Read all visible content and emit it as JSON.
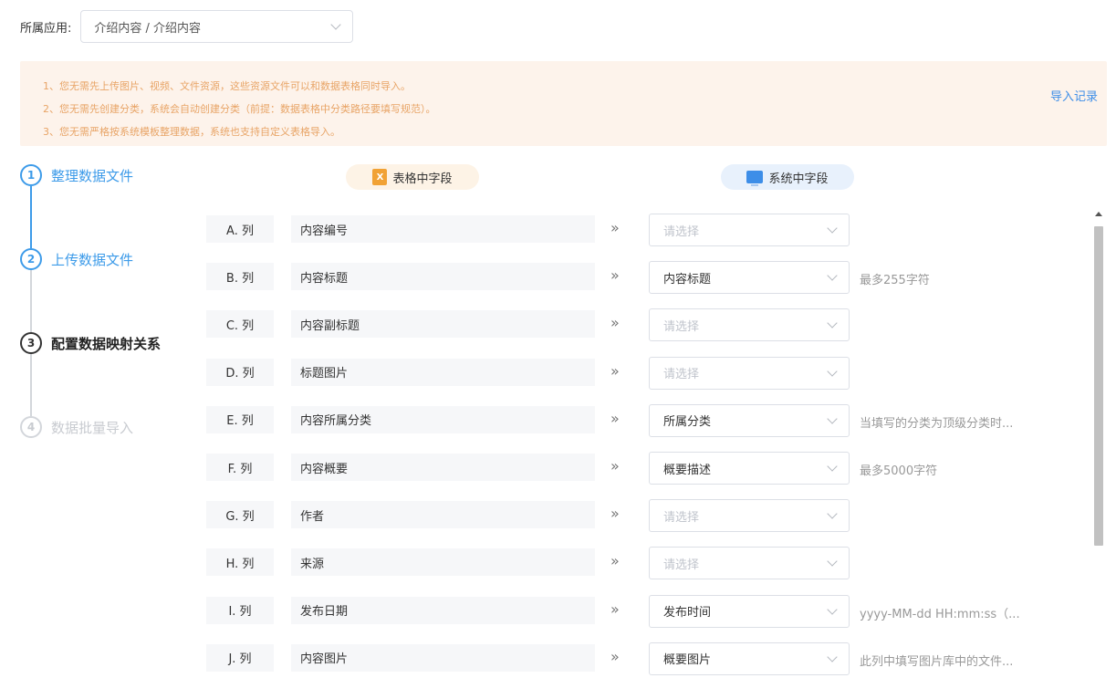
{
  "header": {
    "app_label": "所属应用:",
    "app_value": "介绍内容 / 介绍内容"
  },
  "notice": {
    "lines": [
      "1、您无需先上传图片、视频、文件资源，这些资源文件可以和数据表格同时导入。",
      "2、您无需先创建分类，系统会自动创建分类（前提：数据表格中分类路径要填写规范）。",
      "3、您无需严格按系统模板整理数据，系统也支持自定义表格导入。"
    ],
    "import_record": "导入记录"
  },
  "steps": [
    {
      "num": "1",
      "label": "整理数据文件",
      "state": "active"
    },
    {
      "num": "2",
      "label": "上传数据文件",
      "state": "active"
    },
    {
      "num": "3",
      "label": "配置数据映射关系",
      "state": "current"
    },
    {
      "num": "4",
      "label": "数据批量导入",
      "state": "pending"
    }
  ],
  "columns": {
    "excel_header": "表格中字段",
    "excel_icon_text": "X",
    "system_header": "系统中字段"
  },
  "mappings": [
    {
      "col": "A. 列",
      "field": "内容编号",
      "select": "请选择",
      "placeholder": true,
      "hint": ""
    },
    {
      "col": "B. 列",
      "field": "内容标题",
      "select": "内容标题",
      "placeholder": false,
      "hint": "最多255字符"
    },
    {
      "col": "C. 列",
      "field": "内容副标题",
      "select": "请选择",
      "placeholder": true,
      "hint": ""
    },
    {
      "col": "D. 列",
      "field": "标题图片",
      "select": "请选择",
      "placeholder": true,
      "hint": ""
    },
    {
      "col": "E. 列",
      "field": "内容所属分类",
      "select": "所属分类",
      "placeholder": false,
      "hint": "当填写的分类为顶级分类时..."
    },
    {
      "col": "F. 列",
      "field": "内容概要",
      "select": "概要描述",
      "placeholder": false,
      "hint": "最多5000字符"
    },
    {
      "col": "G. 列",
      "field": "作者",
      "select": "请选择",
      "placeholder": true,
      "hint": ""
    },
    {
      "col": "H. 列",
      "field": "来源",
      "select": "请选择",
      "placeholder": true,
      "hint": ""
    },
    {
      "col": "I. 列",
      "field": "发布日期",
      "select": "发布时间",
      "placeholder": false,
      "hint": "yyyy-MM-dd HH:mm:ss（..."
    },
    {
      "col": "J. 列",
      "field": "内容图片",
      "select": "概要图片",
      "placeholder": false,
      "hint": "此列中填写图片库中的文件..."
    }
  ],
  "arrow_glyph": "»",
  "colors": {
    "accent": "#3d9be9",
    "notice_bg": "#fdf3eb",
    "notice_text": "#e8a466"
  }
}
